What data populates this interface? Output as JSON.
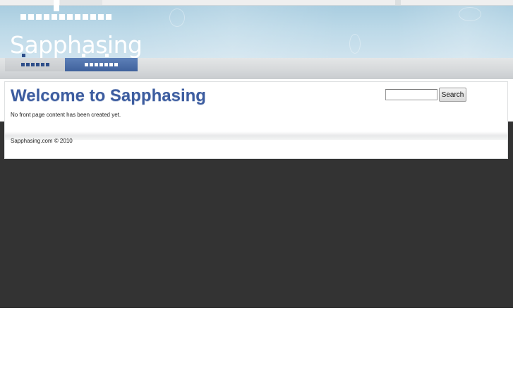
{
  "site": {
    "name": "Sapphasing"
  },
  "nav": {
    "tabs": [
      {
        "label": "",
        "active": false
      },
      {
        "label": "",
        "active": true
      }
    ]
  },
  "main": {
    "title": "Welcome to Sapphasing",
    "message": "No front page content has been created yet."
  },
  "search": {
    "value": "",
    "placeholder": "",
    "button_label": "Search"
  },
  "footer": {
    "text": "Sapphasing.com © 2010"
  },
  "colors": {
    "title": "#3d5da0",
    "tab_active": "#4a6ba8",
    "banner": "#bcd9e8",
    "page_background": "#333333"
  }
}
